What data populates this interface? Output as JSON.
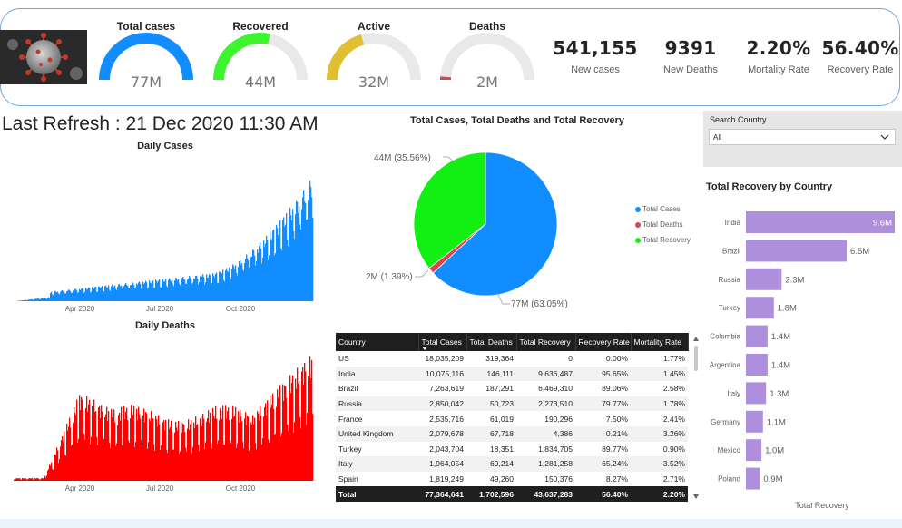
{
  "kpi": {
    "gauges": [
      {
        "title": "Total cases",
        "value": "77M",
        "fill": 1.0,
        "color": "#118DFF"
      },
      {
        "title": "Recovered",
        "value": "44M",
        "fill": 0.5656,
        "color": "#3DF52E"
      },
      {
        "title": "Active",
        "value": "32M",
        "fill": 0.4124,
        "color": "#E0C030"
      },
      {
        "title": "Deaths",
        "value": "2M",
        "fill": 0.022,
        "color": "#D64550"
      }
    ],
    "cards": [
      {
        "value": "541,155",
        "label": "New cases"
      },
      {
        "value": "9391",
        "label": "New Deaths"
      },
      {
        "value": "2.20%",
        "label": "Mortality Rate"
      },
      {
        "value": "56.40%",
        "label": "Recovery Rate"
      }
    ]
  },
  "refresh": {
    "text": "Last Refresh : 21 Dec 2020 11:30 AM"
  },
  "daily_cases": {
    "title": "Daily Cases",
    "color": "#118DFF",
    "x_ticks": [
      "Apr 2020",
      "Jul 2020",
      "Oct 2020"
    ]
  },
  "daily_deaths": {
    "title": "Daily Deaths",
    "color": "#FF0000",
    "x_ticks": [
      "Apr 2020",
      "Jul 2020",
      "Oct 2020"
    ]
  },
  "pie": {
    "title": "Total Cases, Total Deaths and Total Recovery",
    "legend": [
      "Total Cases",
      "Total Deaths",
      "Total Recovery"
    ],
    "colors": [
      "#118DFF",
      "#D64550",
      "#12EF12"
    ]
  },
  "search": {
    "label": "Search Country",
    "value": "All"
  },
  "recovery_chart": {
    "title": "Total Recovery by Country",
    "xlabel": "Total Recovery",
    "bar_color": "#AE8FDE"
  },
  "table": {
    "headers": [
      "Country",
      "Total Cases",
      "Total Deaths",
      "Total Recovery",
      "Recovery Rate",
      "Mortality Rate"
    ],
    "rows": [
      [
        "US",
        "18,035,209",
        "319,364",
        "0",
        "0.00%",
        "1.77%"
      ],
      [
        "India",
        "10,075,116",
        "146,111",
        "9,636,487",
        "95.65%",
        "1.45%"
      ],
      [
        "Brazil",
        "7,263,619",
        "187,291",
        "6,469,310",
        "89.06%",
        "2.58%"
      ],
      [
        "Russia",
        "2,850,042",
        "50,723",
        "2,273,510",
        "79.77%",
        "1.78%"
      ],
      [
        "France",
        "2,535,716",
        "61,019",
        "190,296",
        "7.50%",
        "2.41%"
      ],
      [
        "United Kingdom",
        "2,079,678",
        "67,718",
        "4,386",
        "0.21%",
        "3.26%"
      ],
      [
        "Turkey",
        "2,043,704",
        "18,351",
        "1,834,705",
        "89.77%",
        "0.90%"
      ],
      [
        "Italy",
        "1,964,054",
        "69,214",
        "1,281,258",
        "65.24%",
        "3.52%"
      ],
      [
        "Spain",
        "1,819,249",
        "49,260",
        "150,376",
        "8.27%",
        "2.71%"
      ]
    ],
    "total": [
      "Total",
      "77,364,641",
      "1,702,596",
      "43,637,283",
      "56.40%",
      "2.20%"
    ]
  },
  "chart_data": [
    {
      "type": "pie",
      "title": "Total Cases, Total Deaths and Total Recovery",
      "slices": [
        {
          "name": "Total Cases",
          "value": 77364641,
          "label": "77M (63.05%)"
        },
        {
          "name": "Total Deaths",
          "value": 1702596,
          "label": "2M (1.39%)"
        },
        {
          "name": "Total Recovery",
          "value": 43637283,
          "label": "44M (35.56%)"
        }
      ]
    },
    {
      "type": "bar",
      "title": "Total Recovery by Country",
      "xlabel": "Total Recovery",
      "categories": [
        "India",
        "Brazil",
        "Russia",
        "Turkey",
        "Colombia",
        "Argentina",
        "Italy",
        "Germany",
        "Mexico",
        "Poland"
      ],
      "values": [
        9.6,
        6.5,
        2.3,
        1.8,
        1.4,
        1.4,
        1.3,
        1.1,
        1.0,
        0.9
      ],
      "labels": [
        "9.6M",
        "6.5M",
        "2.3M",
        "1.8M",
        "1.4M",
        "1.4M",
        "1.3M",
        "1.1M",
        "1.0M",
        "0.9M"
      ]
    }
  ]
}
